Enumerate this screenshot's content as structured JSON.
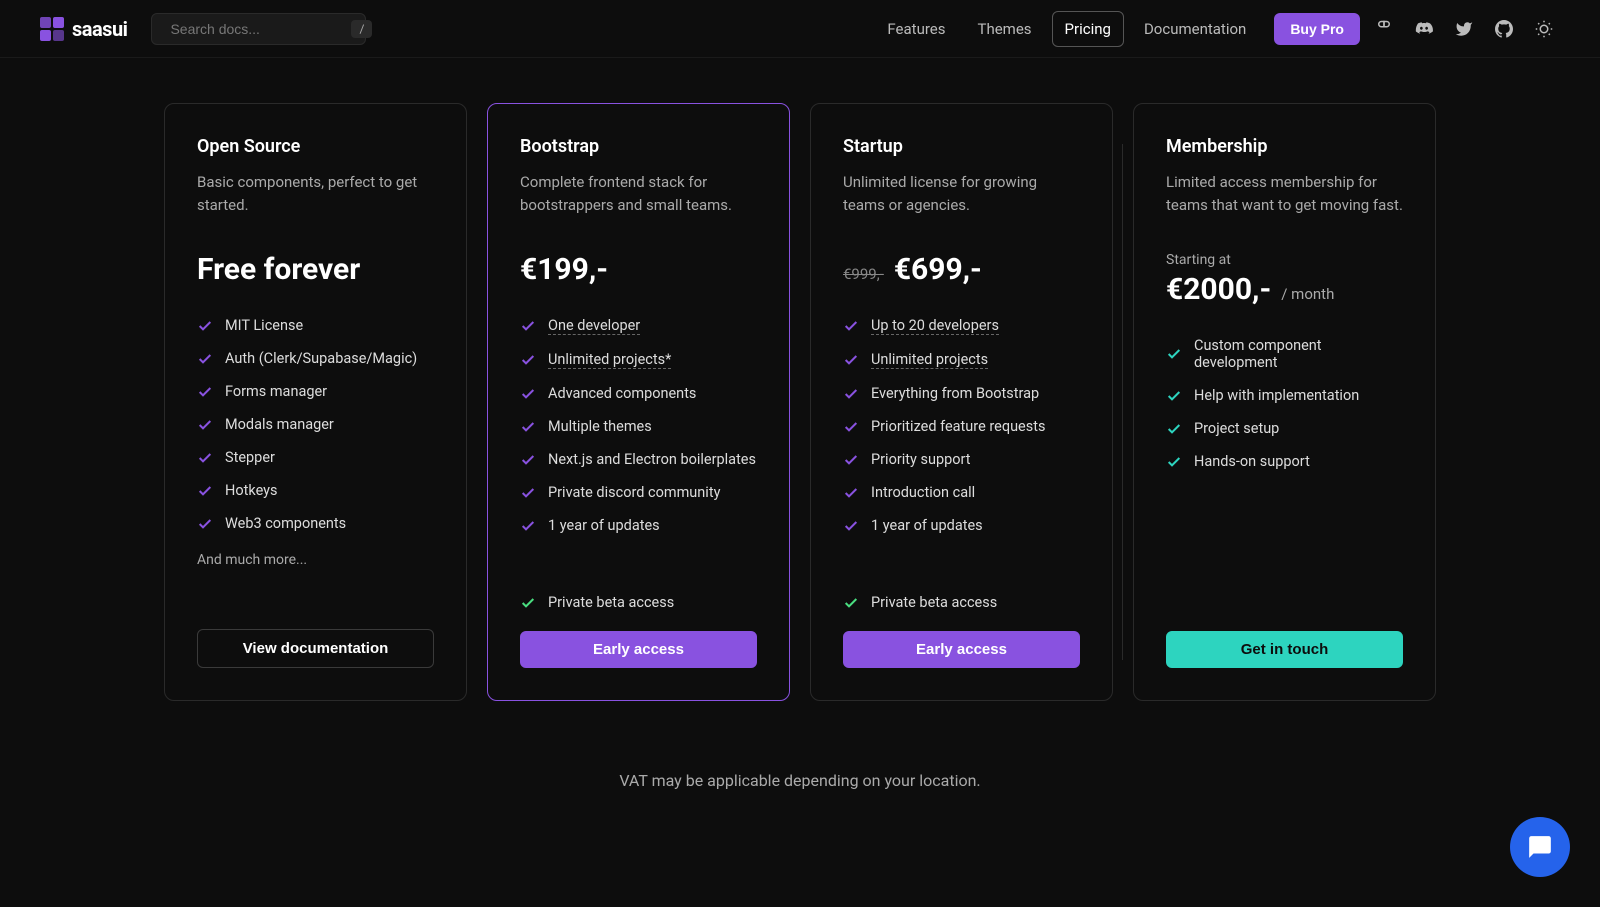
{
  "brand": "saasui",
  "search": {
    "placeholder": "Search docs...",
    "hotkey": "/"
  },
  "nav": {
    "features": "Features",
    "themes": "Themes",
    "pricing": "Pricing",
    "documentation": "Documentation",
    "buy_pro": "Buy Pro"
  },
  "vat_note": "VAT may be applicable depending on your location.",
  "plans": {
    "opensource": {
      "title": "Open Source",
      "desc": "Basic components, perfect to get started.",
      "price": "Free forever",
      "features": [
        "MIT License",
        "Auth (Clerk/Supabase/Magic)",
        "Forms manager",
        "Modals manager",
        "Stepper",
        "Hotkeys",
        "Web3 components"
      ],
      "more": "And much more...",
      "cta": "View documentation"
    },
    "bootstrap": {
      "title": "Bootstrap",
      "desc": "Complete frontend stack for bootstrappers and small teams.",
      "price": "€199,-",
      "features_underlined": [
        "One developer",
        "Unlimited projects*"
      ],
      "features": [
        "Advanced components",
        "Multiple themes",
        "Next.js and Electron boilerplates",
        "Private discord community",
        "1 year of updates"
      ],
      "bonus": "Private beta access",
      "cta": "Early access"
    },
    "startup": {
      "title": "Startup",
      "desc": "Unlimited license for growing teams or agencies.",
      "price_strike": "€999,-",
      "price": "€699,-",
      "features_underlined": [
        "Up to 20 developers",
        "Unlimited projects"
      ],
      "features": [
        "Everything from Bootstrap",
        "Prioritized feature requests",
        "Priority support",
        "Introduction call",
        "1 year of updates"
      ],
      "bonus": "Private beta access",
      "cta": "Early access"
    },
    "membership": {
      "title": "Membership",
      "desc": "Limited access membership for teams that want to get moving fast.",
      "starting": "Starting at",
      "price": "€2000,-",
      "suffix": "/ month",
      "features": [
        "Custom component development",
        "Help with implementation",
        "Project setup",
        "Hands-on support"
      ],
      "cta": "Get in touch"
    }
  }
}
